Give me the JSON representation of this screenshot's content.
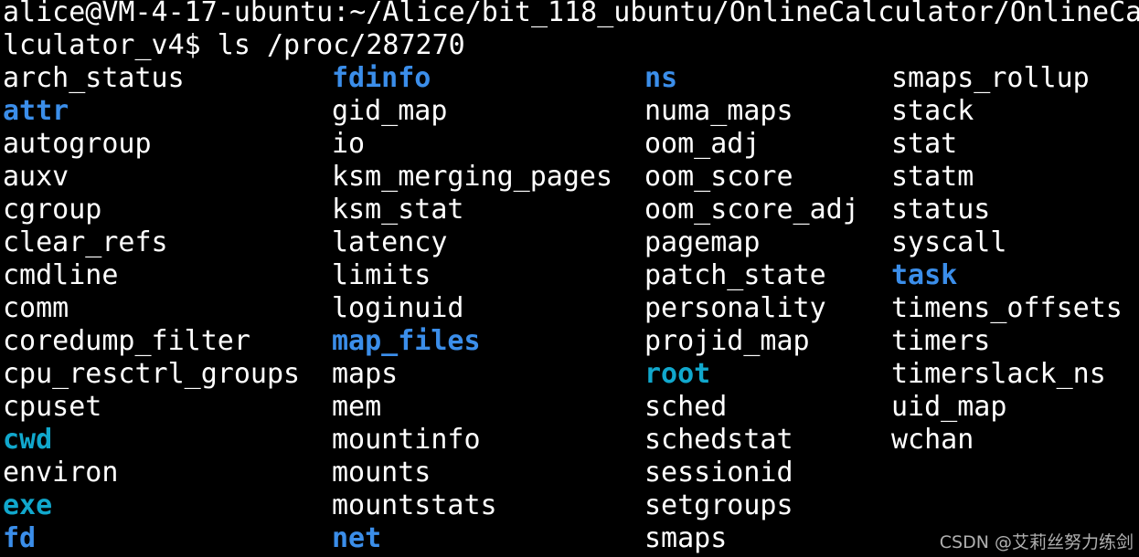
{
  "colors": {
    "background": "#000000",
    "text": "#ffffff",
    "directory": "#3b8eea",
    "symlink": "#11a8cd",
    "watermark": "#cfcfcf"
  },
  "prompt": {
    "line1": "alice@VM-4-17-ubuntu:~/Alice/bit_118_ubuntu/OnlineCalculator/OnlineCa",
    "line2": "lculator_v4$ ls /proc/287270"
  },
  "listing": {
    "columns": [
      [
        {
          "name": "arch_status",
          "type": "file"
        },
        {
          "name": "attr",
          "type": "dir"
        },
        {
          "name": "autogroup",
          "type": "file"
        },
        {
          "name": "auxv",
          "type": "file"
        },
        {
          "name": "cgroup",
          "type": "file"
        },
        {
          "name": "clear_refs",
          "type": "file"
        },
        {
          "name": "cmdline",
          "type": "file"
        },
        {
          "name": "comm",
          "type": "file"
        },
        {
          "name": "coredump_filter",
          "type": "file"
        },
        {
          "name": "cpu_resctrl_groups",
          "type": "file"
        },
        {
          "name": "cpuset",
          "type": "file"
        },
        {
          "name": "cwd",
          "type": "link"
        },
        {
          "name": "environ",
          "type": "file"
        },
        {
          "name": "exe",
          "type": "link"
        },
        {
          "name": "fd",
          "type": "dir"
        }
      ],
      [
        {
          "name": "fdinfo",
          "type": "dir"
        },
        {
          "name": "gid_map",
          "type": "file"
        },
        {
          "name": "io",
          "type": "file"
        },
        {
          "name": "ksm_merging_pages",
          "type": "file"
        },
        {
          "name": "ksm_stat",
          "type": "file"
        },
        {
          "name": "latency",
          "type": "file"
        },
        {
          "name": "limits",
          "type": "file"
        },
        {
          "name": "loginuid",
          "type": "file"
        },
        {
          "name": "map_files",
          "type": "dir"
        },
        {
          "name": "maps",
          "type": "file"
        },
        {
          "name": "mem",
          "type": "file"
        },
        {
          "name": "mountinfo",
          "type": "file"
        },
        {
          "name": "mounts",
          "type": "file"
        },
        {
          "name": "mountstats",
          "type": "file"
        },
        {
          "name": "net",
          "type": "dir"
        }
      ],
      [
        {
          "name": "ns",
          "type": "dir"
        },
        {
          "name": "numa_maps",
          "type": "file"
        },
        {
          "name": "oom_adj",
          "type": "file"
        },
        {
          "name": "oom_score",
          "type": "file"
        },
        {
          "name": "oom_score_adj",
          "type": "file"
        },
        {
          "name": "pagemap",
          "type": "file"
        },
        {
          "name": "patch_state",
          "type": "file"
        },
        {
          "name": "personality",
          "type": "file"
        },
        {
          "name": "projid_map",
          "type": "file"
        },
        {
          "name": "root",
          "type": "link"
        },
        {
          "name": "sched",
          "type": "file"
        },
        {
          "name": "schedstat",
          "type": "file"
        },
        {
          "name": "sessionid",
          "type": "file"
        },
        {
          "name": "setgroups",
          "type": "file"
        },
        {
          "name": "smaps",
          "type": "file"
        }
      ],
      [
        {
          "name": "smaps_rollup",
          "type": "file"
        },
        {
          "name": "stack",
          "type": "file"
        },
        {
          "name": "stat",
          "type": "file"
        },
        {
          "name": "statm",
          "type": "file"
        },
        {
          "name": "status",
          "type": "file"
        },
        {
          "name": "syscall",
          "type": "file"
        },
        {
          "name": "task",
          "type": "dir"
        },
        {
          "name": "timens_offsets",
          "type": "file"
        },
        {
          "name": "timers",
          "type": "file"
        },
        {
          "name": "timerslack_ns",
          "type": "file"
        },
        {
          "name": "uid_map",
          "type": "file"
        },
        {
          "name": "wchan",
          "type": "file"
        }
      ]
    ]
  },
  "watermark": "CSDN @艾莉丝努力练剑"
}
